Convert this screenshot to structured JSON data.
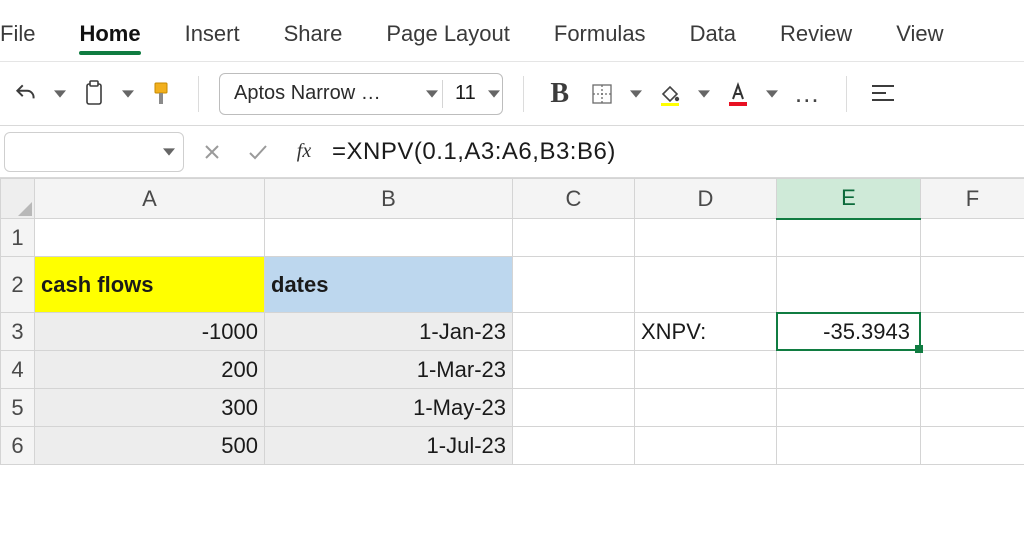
{
  "ribbon": {
    "tabs": [
      "File",
      "Home",
      "Insert",
      "Share",
      "Page Layout",
      "Formulas",
      "Data",
      "Review",
      "View"
    ],
    "active_index": 1
  },
  "toolbar": {
    "font_name": "Aptos Narrow …",
    "font_size": "11",
    "bold_label": "B",
    "icons": {
      "undo": "undo-icon",
      "clipboard": "clipboard-icon",
      "format_painter": "format-painter-icon",
      "borders": "borders-icon",
      "fill": "fill-color-icon",
      "font_color": "font-color-icon",
      "overflow": "…",
      "align": "align-left-icon"
    }
  },
  "formula_bar": {
    "name_box": "",
    "fx_label": "fx",
    "formula": "=XNPV(0.1,A3:A6,B3:B6)"
  },
  "grid": {
    "columns": [
      "A",
      "B",
      "C",
      "D",
      "E",
      "F"
    ],
    "selected_column": "E",
    "rows": [
      "1",
      "2",
      "3",
      "4",
      "5",
      "6"
    ],
    "headers": {
      "A": "cash flows",
      "B": "dates"
    },
    "data": {
      "A": [
        "-1000",
        "200",
        "300",
        "500"
      ],
      "B": [
        "1-Jan-23",
        "1-Mar-23",
        "1-May-23",
        "1-Jul-23"
      ]
    },
    "label_D3": "XNPV:",
    "result_E3": "-35.3943",
    "selected_cell": "E3"
  },
  "chart_data": {
    "type": "table",
    "title": "XNPV example",
    "columns": [
      "cash flows",
      "dates"
    ],
    "rows": [
      {
        "cash_flow": -1000,
        "date": "1-Jan-23"
      },
      {
        "cash_flow": 200,
        "date": "1-Mar-23"
      },
      {
        "cash_flow": 300,
        "date": "1-May-23"
      },
      {
        "cash_flow": 500,
        "date": "1-Jul-23"
      }
    ],
    "rate": 0.1,
    "xnpv_result": -35.3943
  }
}
